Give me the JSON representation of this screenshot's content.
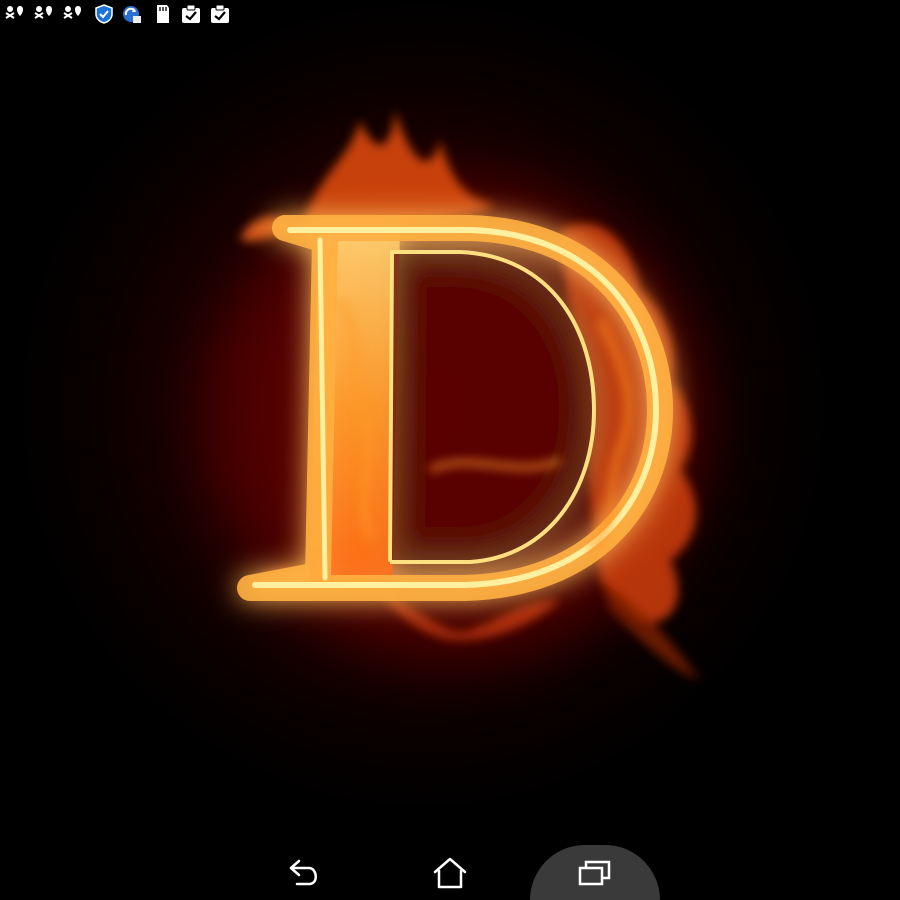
{
  "status_bar": {
    "icons": [
      "people-location-icon",
      "people-location-icon",
      "people-location-icon",
      "shield-icon",
      "update-icon",
      "sd-card-icon",
      "clipboard-check-icon",
      "clipboard-check-icon"
    ]
  },
  "wallpaper": {
    "letter": "D",
    "colors": {
      "flame_core": "#fff4b0",
      "flame_mid": "#ffb340",
      "flame_outer": "#e8480a",
      "glow": "#7a0a00"
    }
  },
  "nav_bar": {
    "buttons": [
      "back-icon",
      "home-icon",
      "recent-apps-icon"
    ],
    "active": "recent-apps-icon",
    "colors": {
      "icon": "#ffffff",
      "active_bg": "#3a3a3a"
    }
  }
}
